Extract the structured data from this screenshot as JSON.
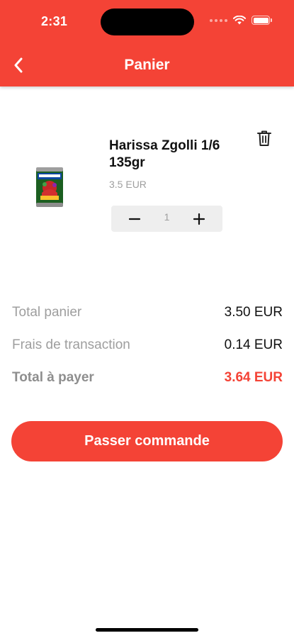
{
  "status_bar": {
    "time": "2:31"
  },
  "header": {
    "title": "Panier",
    "back_icon": "chevron-left-icon",
    "color": "#f44336"
  },
  "cart": {
    "items": [
      {
        "name": "Harissa Zgolli 1/6 135gr",
        "price": "3.5 EUR",
        "quantity": "1",
        "image_icon": "harissa-can-image"
      }
    ]
  },
  "summary": {
    "rows": [
      {
        "label": "Total panier",
        "value": "3.50 EUR"
      },
      {
        "label": "Frais de transaction",
        "value": "0.14 EUR"
      },
      {
        "label": "Total à payer",
        "value": "3.64 EUR"
      }
    ]
  },
  "checkout_button": {
    "label": "Passer commande"
  },
  "colors": {
    "accent": "#f44336",
    "muted_text": "#9e9e9e"
  }
}
